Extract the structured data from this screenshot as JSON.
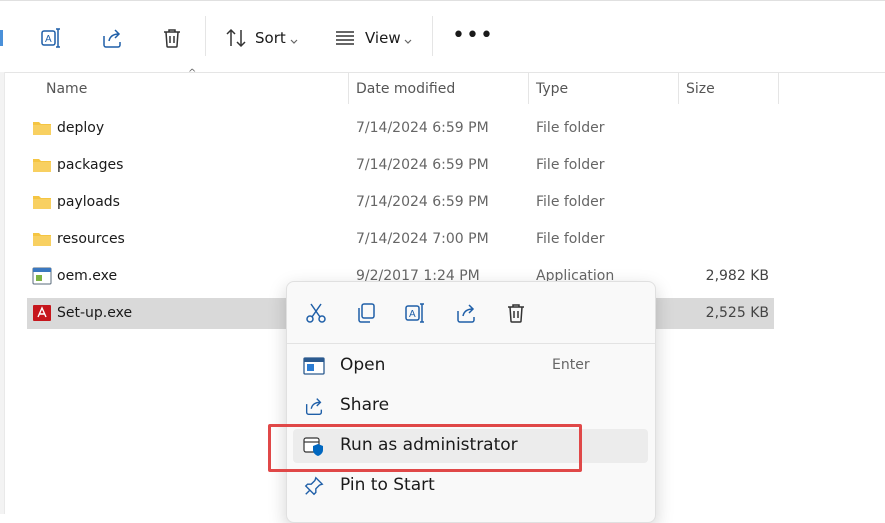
{
  "toolbar": {
    "sort_label": "Sort",
    "view_label": "View",
    "more_label": "•••"
  },
  "columns": {
    "name": "Name",
    "date": "Date modified",
    "type": "Type",
    "size": "Size"
  },
  "files": [
    {
      "name": "deploy",
      "date": "7/14/2024 6:59 PM",
      "type": "File folder",
      "size": ""
    },
    {
      "name": "packages",
      "date": "7/14/2024 6:59 PM",
      "type": "File folder",
      "size": ""
    },
    {
      "name": "payloads",
      "date": "7/14/2024 6:59 PM",
      "type": "File folder",
      "size": ""
    },
    {
      "name": "resources",
      "date": "7/14/2024 7:00 PM",
      "type": "File folder",
      "size": ""
    },
    {
      "name": "oem.exe",
      "date": "9/2/2017 1:24 PM",
      "type": "Application",
      "size": "2,982 KB"
    },
    {
      "name": "Set-up.exe",
      "date": "",
      "type": "",
      "size": "2,525 KB"
    }
  ],
  "context_menu": {
    "quick_actions": [
      "cut-icon",
      "copy-icon",
      "rename-icon",
      "share-icon",
      "delete-icon"
    ],
    "items": [
      {
        "label": "Open",
        "shortcut": "Enter",
        "icon": "open-icon"
      },
      {
        "label": "Share",
        "shortcut": "",
        "icon": "share-icon"
      },
      {
        "label": "Run as administrator",
        "shortcut": "",
        "icon": "shield-icon"
      },
      {
        "label": "Pin to Start",
        "shortcut": "",
        "icon": "pin-icon"
      }
    ]
  },
  "colors": {
    "selection": "#d9d9d9",
    "highlight": "#e04848",
    "folder": "#f5c542",
    "accent": "#0067c0"
  }
}
